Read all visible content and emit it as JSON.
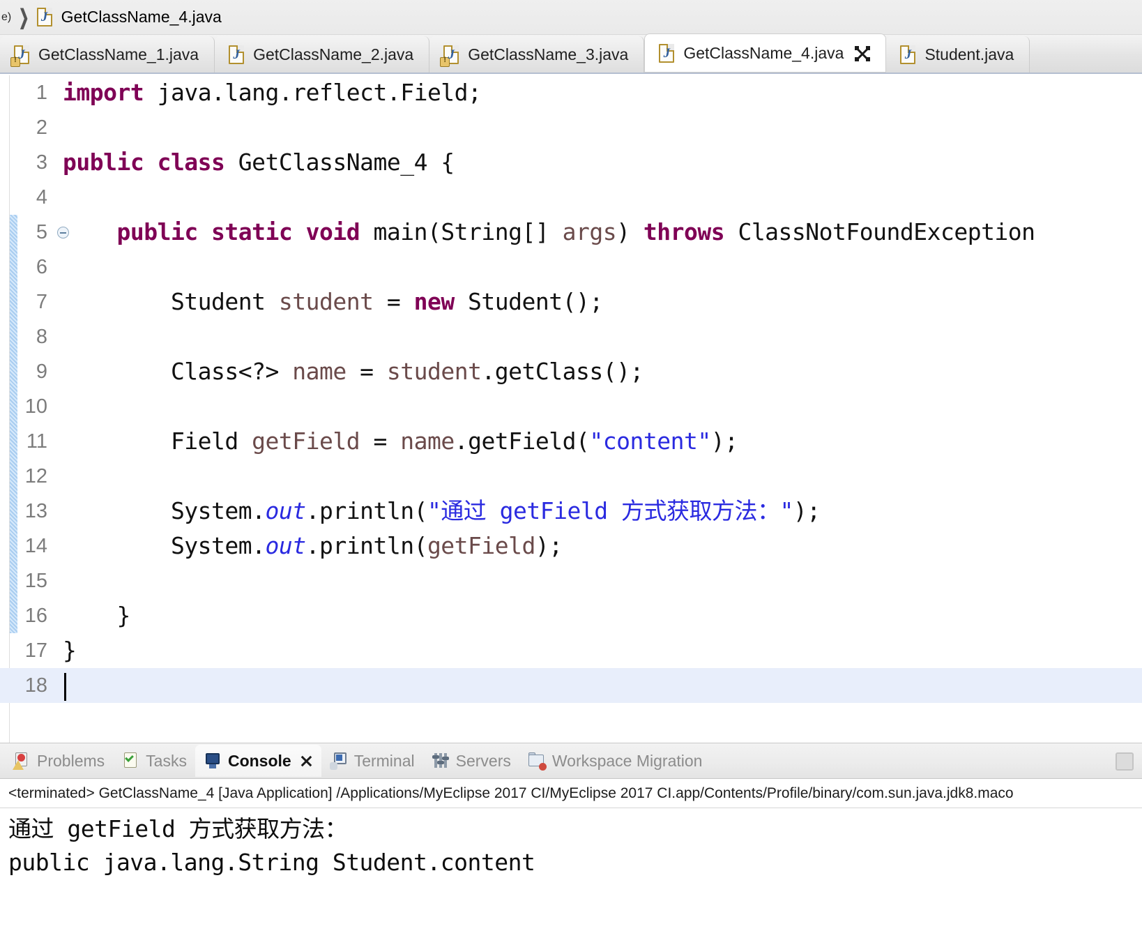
{
  "breadcrumb": {
    "prefix_text": "e)",
    "separator": "❯",
    "file_icon": "java-file-icon",
    "file_label": "GetClassName_4.java"
  },
  "editor_tabs": [
    {
      "label": "GetClassName_1.java",
      "icon": "java-file-warning-icon",
      "active": false,
      "warning": true,
      "closable": false
    },
    {
      "label": "GetClassName_2.java",
      "icon": "java-file-icon",
      "active": false,
      "warning": false,
      "closable": false
    },
    {
      "label": "GetClassName_3.java",
      "icon": "java-file-warning-icon",
      "active": false,
      "warning": true,
      "closable": false
    },
    {
      "label": "GetClassName_4.java",
      "icon": "java-file-icon",
      "active": true,
      "warning": false,
      "closable": true
    },
    {
      "label": "Student.java",
      "icon": "java-file-icon",
      "active": false,
      "warning": false,
      "closable": false
    }
  ],
  "editor": {
    "first_line": 1,
    "last_line": 18,
    "current_line": 18,
    "fold_marker_line": 5,
    "change_bar_from_line": 5,
    "change_bar_to_line": 16,
    "lines": [
      {
        "n": "1",
        "tokens": [
          {
            "t": "import",
            "c": "kw"
          },
          {
            "t": " java.lang.reflect.Field;",
            "c": "plain"
          }
        ]
      },
      {
        "n": "2",
        "tokens": []
      },
      {
        "n": "3",
        "tokens": [
          {
            "t": "public class",
            "c": "kw"
          },
          {
            "t": " GetClassName_4 {",
            "c": "plain"
          }
        ]
      },
      {
        "n": "4",
        "tokens": []
      },
      {
        "n": "5",
        "tokens": [
          {
            "t": "    ",
            "c": "plain"
          },
          {
            "t": "public static void",
            "c": "kw"
          },
          {
            "t": " main(String[] ",
            "c": "plain"
          },
          {
            "t": "args",
            "c": "fieldv"
          },
          {
            "t": ") ",
            "c": "plain"
          },
          {
            "t": "throws",
            "c": "kw"
          },
          {
            "t": " ClassNotFoundException",
            "c": "plain"
          }
        ]
      },
      {
        "n": "6",
        "tokens": []
      },
      {
        "n": "7",
        "tokens": [
          {
            "t": "        Student ",
            "c": "plain"
          },
          {
            "t": "student",
            "c": "fieldv"
          },
          {
            "t": " = ",
            "c": "plain"
          },
          {
            "t": "new",
            "c": "kw"
          },
          {
            "t": " Student();",
            "c": "plain"
          }
        ]
      },
      {
        "n": "8",
        "tokens": []
      },
      {
        "n": "9",
        "tokens": [
          {
            "t": "        Class<?> ",
            "c": "plain"
          },
          {
            "t": "name",
            "c": "fieldv"
          },
          {
            "t": " = ",
            "c": "plain"
          },
          {
            "t": "student",
            "c": "fieldv"
          },
          {
            "t": ".getClass();",
            "c": "plain"
          }
        ]
      },
      {
        "n": "10",
        "tokens": []
      },
      {
        "n": "11",
        "tokens": [
          {
            "t": "        Field ",
            "c": "plain"
          },
          {
            "t": "getField",
            "c": "fieldv"
          },
          {
            "t": " = ",
            "c": "plain"
          },
          {
            "t": "name",
            "c": "fieldv"
          },
          {
            "t": ".getField(",
            "c": "plain"
          },
          {
            "t": "\"content\"",
            "c": "str"
          },
          {
            "t": ");",
            "c": "plain"
          }
        ]
      },
      {
        "n": "12",
        "tokens": []
      },
      {
        "n": "13",
        "tokens": [
          {
            "t": "        System.",
            "c": "plain"
          },
          {
            "t": "out",
            "c": "stat"
          },
          {
            "t": ".println(",
            "c": "plain"
          },
          {
            "t": "\"通过 getField 方式获取方法：\"",
            "c": "str"
          },
          {
            "t": ");",
            "c": "plain"
          }
        ]
      },
      {
        "n": "14",
        "tokens": [
          {
            "t": "        System.",
            "c": "plain"
          },
          {
            "t": "out",
            "c": "stat"
          },
          {
            "t": ".println(",
            "c": "plain"
          },
          {
            "t": "getField",
            "c": "fieldv"
          },
          {
            "t": ");",
            "c": "plain"
          }
        ]
      },
      {
        "n": "15",
        "tokens": []
      },
      {
        "n": "16",
        "tokens": [
          {
            "t": "    }",
            "c": "plain"
          }
        ]
      },
      {
        "n": "17",
        "tokens": [
          {
            "t": "}",
            "c": "plain"
          }
        ]
      },
      {
        "n": "18",
        "tokens": [],
        "caret": true
      }
    ]
  },
  "console_panel": {
    "tabs": [
      {
        "label": "Problems",
        "icon": "problems-icon",
        "active": false,
        "closable": false
      },
      {
        "label": "Tasks",
        "icon": "tasks-icon",
        "active": false,
        "closable": false
      },
      {
        "label": "Console",
        "icon": "console-icon",
        "active": true,
        "closable": true
      },
      {
        "label": "Terminal",
        "icon": "terminal-icon",
        "active": false,
        "closable": false
      },
      {
        "label": "Servers",
        "icon": "servers-icon",
        "active": false,
        "closable": false
      },
      {
        "label": "Workspace Migration",
        "icon": "workspace-migration-icon",
        "active": false,
        "closable": false
      }
    ],
    "toolbar_button": "minimize-restore-button",
    "meta_line": "<terminated> GetClassName_4 [Java Application] /Applications/MyEclipse 2017 CI/MyEclipse 2017 CI.app/Contents/Profile/binary/com.sun.java.jdk8.maco",
    "output_lines": [
      "通过 getField 方式获取方法：",
      "public java.lang.String Student.content"
    ]
  },
  "colors": {
    "keyword": "#7f0055",
    "string": "#2a2ae0",
    "field": "#6a4a4a",
    "static_field": "#2a2ae0",
    "current_line_bg": "#e8eefb",
    "change_bar": "#a9cdf0",
    "tab_active_bg": "#ffffff",
    "panel_bg": "#eaeaea"
  }
}
